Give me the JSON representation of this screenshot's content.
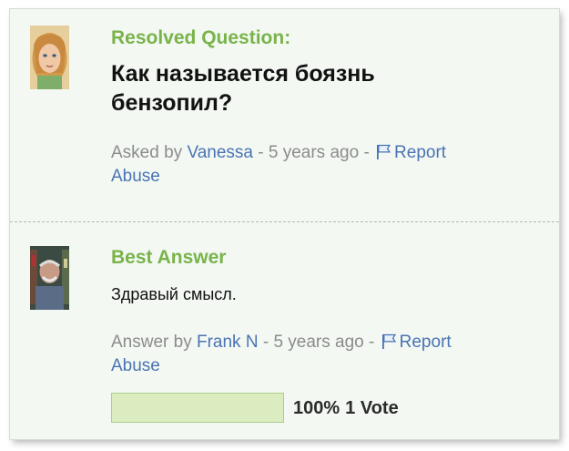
{
  "question": {
    "heading": "Resolved Question:",
    "text": "Как называется боязнь бензопил?",
    "meta": {
      "asked_by_label": "Asked by",
      "author": "Vanessa",
      "separator": "-",
      "time": "5 years ago",
      "report_label": "Report",
      "abuse_label": "Abuse"
    }
  },
  "answer": {
    "heading": "Best Answer",
    "text": "Здравый смысл.",
    "meta": {
      "answer_by_label": "Answer by",
      "author": "Frank N",
      "separator": "-",
      "time": "5 years ago",
      "report_label": "Report",
      "abuse_label": "Abuse"
    },
    "votes": {
      "percent": "100%",
      "count_label": "1 Vote",
      "fill_fraction": 1.0
    }
  },
  "colors": {
    "heading_green": "#79b34a",
    "link_blue": "#4a73b3",
    "meta_gray": "#8b8b8b",
    "background": "#f3f8f3"
  },
  "icons": [
    "flag-icon"
  ]
}
